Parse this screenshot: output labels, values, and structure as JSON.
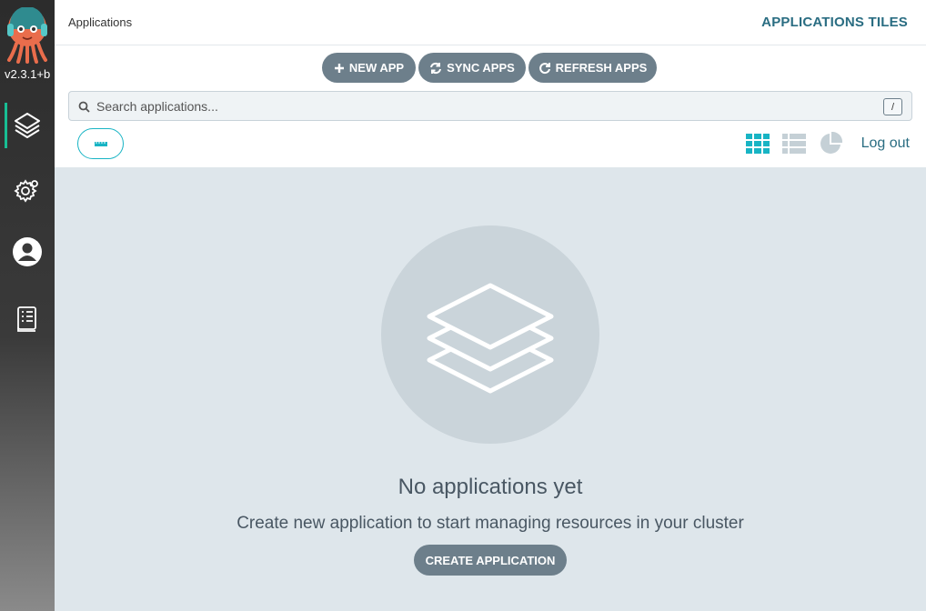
{
  "sidebar": {
    "version": "v2.3.1+b",
    "items": [
      {
        "name": "applications",
        "icon": "layers-icon"
      },
      {
        "name": "settings",
        "icon": "gear-icon"
      },
      {
        "name": "user-info",
        "icon": "user-icon"
      },
      {
        "name": "documentation",
        "icon": "book-icon"
      }
    ]
  },
  "header": {
    "breadcrumb": "Applications",
    "title": "APPLICATIONS TILES"
  },
  "toolbar": {
    "new_app": "NEW APP",
    "sync_apps": "SYNC APPS",
    "refresh_apps": "REFRESH APPS"
  },
  "search": {
    "placeholder": "Search applications...",
    "shortcut": "/"
  },
  "view": {
    "logout": "Log out",
    "modes": [
      "tiles",
      "list",
      "summary"
    ],
    "active_mode": "tiles"
  },
  "empty_state": {
    "title": "No applications yet",
    "subtitle": "Create new application to start managing resources in your cluster",
    "button": "CREATE APPLICATION"
  },
  "colors": {
    "accent": "#18b4c4",
    "title": "#2a6d82",
    "button": "#6d7f8b",
    "background": "#dee6eb"
  }
}
